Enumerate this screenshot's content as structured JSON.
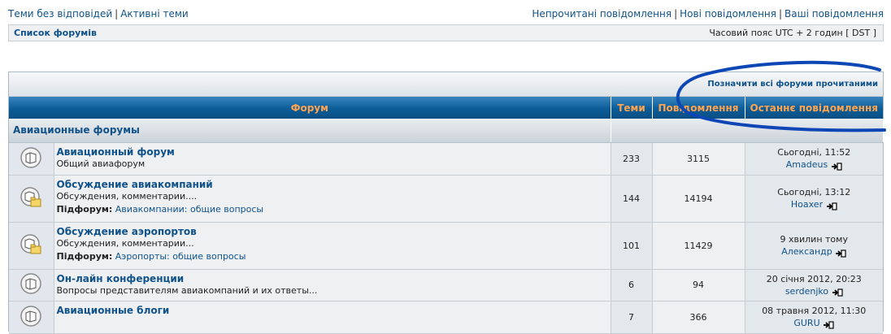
{
  "top": {
    "left_links": [
      "Теми без відповідей",
      "Активні теми"
    ],
    "right_links": [
      "Непрочитані повідомлення",
      "Нові повідомлення",
      "Ваші повідомлення"
    ]
  },
  "navbar": {
    "crumb": "Список форумів",
    "timezone": "Часовий пояс UTC + 2 годин [ DST ]"
  },
  "mark_all_read": "Позначити всі форуми прочитаними",
  "table": {
    "headers": [
      "Форум",
      "Теми",
      "Повідомлення",
      "Останнє повідомлення"
    ],
    "category": "Авиационные форумы",
    "subforum_label": "Підфорум:",
    "rows": [
      {
        "title": "Авиационный форум",
        "desc": "Общий авиафорум",
        "subforum": "",
        "topics": "233",
        "posts": "3115",
        "last_time": "Сьогодні, 11:52",
        "last_user": "Amadeus",
        "icon": "forum-read-icon"
      },
      {
        "title": "Обсуждение авиакомпаний",
        "desc": "Обсуждения, комментарии....",
        "subforum": "Авиакомпании: общие вопросы",
        "topics": "144",
        "posts": "14194",
        "last_time": "Сьогодні, 13:12",
        "last_user": "Hoaxer",
        "icon": "forum-subforum-icon"
      },
      {
        "title": "Обсуждение аэропортов",
        "desc": "Обсуждения, комментарии...",
        "subforum": "Аэропорты: общие вопросы",
        "topics": "101",
        "posts": "11429",
        "last_time": "9 хвилин тому",
        "last_user": "Александр",
        "icon": "forum-subforum-icon"
      },
      {
        "title": "Он-лайн конференции",
        "desc": "Вопросы представителям авиакомпаний и их ответы...",
        "subforum": "",
        "topics": "6",
        "posts": "94",
        "last_time": "20 січня 2012, 20:23",
        "last_user": "serdenjko",
        "icon": "forum-read-icon"
      },
      {
        "title": "Авиационные блоги",
        "desc": "",
        "subforum": "",
        "topics": "7",
        "posts": "366",
        "last_time": "08 травня 2012, 11:30",
        "last_user": "GURU",
        "icon": "forum-read-icon"
      }
    ]
  },
  "colors": {
    "header_bg": "#0b5c97",
    "header_text": "#ffa34f",
    "link": "#105289",
    "annotation": "#0d47b5"
  }
}
